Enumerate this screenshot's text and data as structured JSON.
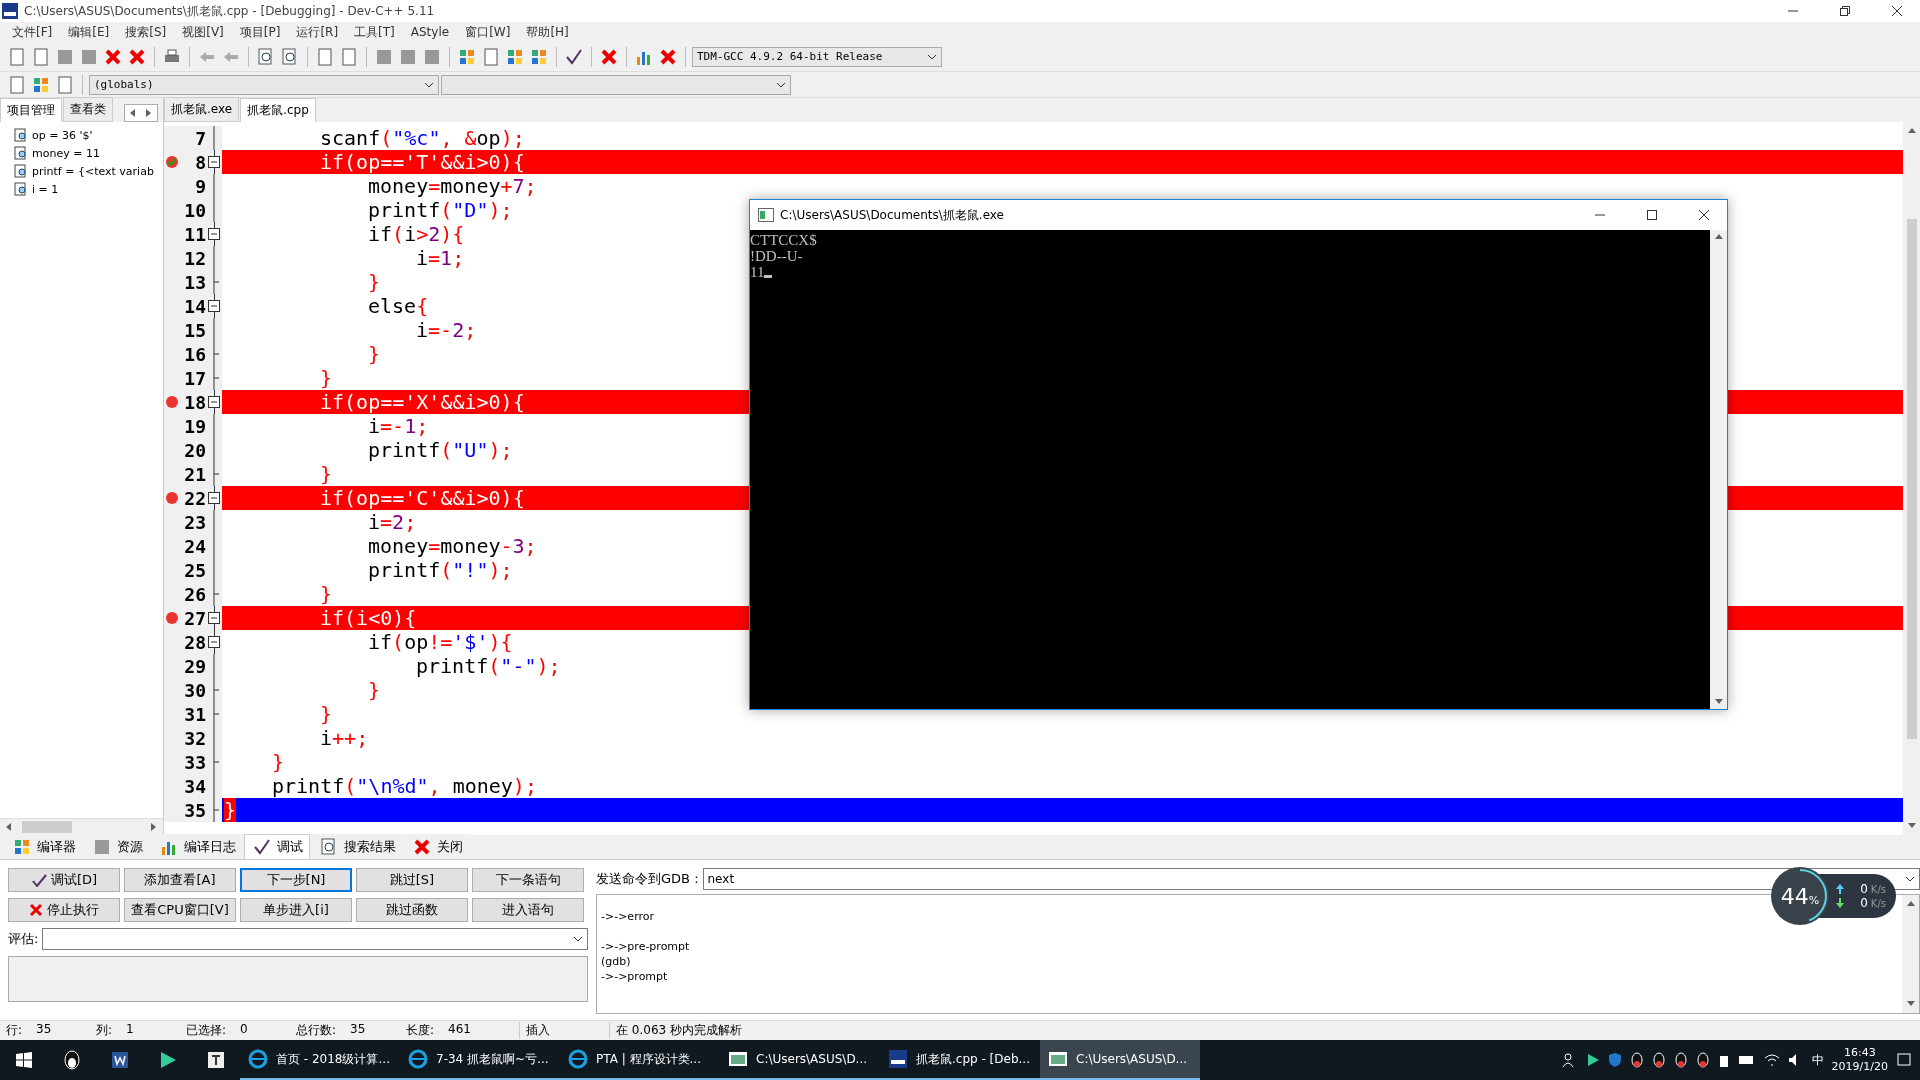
{
  "window": {
    "title": "C:\\Users\\ASUS\\Documents\\抓老鼠.cpp - [Debugging] - Dev-C++ 5.11"
  },
  "menu": [
    "文件[F]",
    "编辑[E]",
    "搜索[S]",
    "视图[V]",
    "项目[P]",
    "运行[R]",
    "工具[T]",
    "AStyle",
    "窗口[W]",
    "帮助[H]"
  ],
  "toolbar": {
    "compiler": "TDM-GCC 4.9.2 64-bit Release",
    "scope": "(globals)"
  },
  "side_tabs": [
    {
      "label": "项目管理",
      "selected": true
    },
    {
      "label": "查看类",
      "selected": false
    }
  ],
  "watches": [
    "op = 36 '$'",
    "money = 11",
    "printf = {<text variab",
    "i = 1"
  ],
  "editor_tabs": [
    {
      "label": "抓老鼠.exe",
      "selected": false
    },
    {
      "label": "抓老鼠.cpp",
      "selected": true
    }
  ],
  "lines": [
    {
      "children": [
        {
          "children": [
            {
              "number": "7",
              "kind": "plain",
              "fold_open": false,
              "fold_end": false,
              "tokens": [
                {
                  "t": "scanf",
                  "kind": "id"
                },
                {
                  "t": "(",
                  "kind": "sym"
                },
                {
                  "t": "\"%c\"",
                  "kind": "str"
                },
                {
                  "t": ", &",
                  "kind": "sym"
                },
                {
                  "t": "op",
                  "kind": "id"
                },
                {
                  "t": ");",
                  "kind": "sym"
                }
              ]
            },
            {
              "number": "8",
              "kind": "breakpoint",
              "fold_open": true,
              "fold_end": false,
              "tokens": [
                {
                  "t": "if(op=='T'&&i>0){",
                  "kind": "id"
                }
              ],
              "children": [
                {
                  "number": "9",
                  "kind": "plain",
                  "fold_open": false,
                  "fold_end": false,
                  "tokens": [
                    {
                      "t": "money",
                      "kind": "id"
                    },
                    {
                      "t": "=",
                      "kind": "sym"
                    },
                    {
                      "t": "money",
                      "kind": "id"
                    },
                    {
                      "t": "+",
                      "kind": "sym"
                    },
                    {
                      "t": "7",
                      "kind": "num"
                    },
                    {
                      "t": ";",
                      "kind": "sym"
                    }
                  ]
                },
                {
                  "number": "10",
                  "kind": "plain",
                  "fold_open": false,
                  "fold_end": false,
                  "tokens": [
                    {
                      "t": "printf",
                      "kind": "id"
                    },
                    {
                      "t": "(",
                      "kind": "sym"
                    },
                    {
                      "t": "\"D\"",
                      "kind": "str"
                    },
                    {
                      "t": ");",
                      "kind": "sym"
                    }
                  ]
                },
                {
                  "number": "11",
                  "kind": "plain",
                  "fold_open": true,
                  "fold_end": false,
                  "tokens": [
                    {
                      "t": "if",
                      "kind": "id"
                    },
                    {
                      "t": "(",
                      "kind": "sym"
                    },
                    {
                      "t": "i",
                      "kind": "id"
                    },
                    {
                      "t": ">",
                      "kind": "sym"
                    },
                    {
                      "t": "2",
                      "kind": "num"
                    },
                    {
                      "t": "){",
                      "kind": "sym"
                    }
                  ],
                  "children": [
                    {
                      "number": "12",
                      "kind": "plain",
                      "fold_open": false,
                      "fold_end": false,
                      "tokens": [
                        {
                          "t": "i",
                          "kind": "id"
                        },
                        {
                          "t": "=",
                          "kind": "sym"
                        },
                        {
                          "t": "1",
                          "kind": "num"
                        },
                        {
                          "t": ";",
                          "kind": "sym"
                        }
                      ]
                    }
                  ]
                },
                {
                  "number": "13",
                  "kind": "plain",
                  "fold_open": false,
                  "fold_end": true,
                  "tokens": [
                    {
                      "t": "}",
                      "kind": "sym"
                    }
                  ]
                },
                {
                  "number": "14",
                  "kind": "plain",
                  "fold_open": true,
                  "fold_end": false,
                  "tokens": [
                    {
                      "t": "else",
                      "kind": "id"
                    },
                    {
                      "t": "{",
                      "kind": "sym"
                    }
                  ],
                  "children": [
                    {
                      "number": "15",
                      "kind": "plain",
                      "fold_open": false,
                      "fold_end": false,
                      "tokens": [
                        {
                          "t": "i",
                          "kind": "id"
                        },
                        {
                          "t": "=-",
                          "kind": "sym"
                        },
                        {
                          "t": "2",
                          "kind": "num"
                        },
                        {
                          "t": ";",
                          "kind": "sym"
                        }
                      ]
                    }
                  ]
                },
                {
                  "number": "16",
                  "kind": "plain",
                  "fold_open": false,
                  "fold_end": true,
                  "tokens": [
                    {
                      "t": "}",
                      "kind": "sym"
                    }
                  ]
                }
              ]
            },
            {
              "number": "17",
              "kind": "plain",
              "fold_open": false,
              "fold_end": true,
              "tokens": [
                {
                  "t": "}",
                  "kind": "sym"
                }
              ]
            },
            {
              "number": "18",
              "kind": "breakpoint",
              "fold_open": true,
              "fold_end": false,
              "tokens": [
                {
                  "t": "if(op=='X'&&i>0){",
                  "kind": "id"
                }
              ],
              "children": [
                {
                  "number": "19",
                  "kind": "plain",
                  "fold_open": false,
                  "fold_end": false,
                  "tokens": [
                    {
                      "t": "i",
                      "kind": "id"
                    },
                    {
                      "t": "=-",
                      "kind": "sym"
                    },
                    {
                      "t": "1",
                      "kind": "num"
                    },
                    {
                      "t": ";",
                      "kind": "sym"
                    }
                  ]
                },
                {
                  "number": "20",
                  "kind": "plain",
                  "fold_open": false,
                  "fold_end": false,
                  "tokens": [
                    {
                      "t": "printf",
                      "kind": "id"
                    },
                    {
                      "t": "(",
                      "kind": "sym"
                    },
                    {
                      "t": "\"U\"",
                      "kind": "str"
                    },
                    {
                      "t": ");",
                      "kind": "sym"
                    }
                  ]
                }
              ]
            },
            {
              "number": "21",
              "kind": "plain",
              "fold_open": false,
              "fold_end": true,
              "tokens": [
                {
                  "t": "}",
                  "kind": "sym"
                }
              ]
            },
            {
              "number": "22",
              "kind": "breakpoint",
              "fold_open": true,
              "fold_end": false,
              "tokens": [
                {
                  "t": "if(op=='C'&&i>0){",
                  "kind": "id"
                }
              ],
              "children": [
                {
                  "number": "23",
                  "kind": "plain",
                  "fold_open": false,
                  "fold_end": false,
                  "tokens": [
                    {
                      "t": "i",
                      "kind": "id"
                    },
                    {
                      "t": "=",
                      "kind": "sym"
                    },
                    {
                      "t": "2",
                      "kind": "num"
                    },
                    {
                      "t": ";",
                      "kind": "sym"
                    }
                  ]
                },
                {
                  "number": "24",
                  "kind": "plain",
                  "fold_open": false,
                  "fold_end": false,
                  "tokens": [
                    {
                      "t": "money",
                      "kind": "id"
                    },
                    {
                      "t": "=",
                      "kind": "sym"
                    },
                    {
                      "t": "money",
                      "kind": "id"
                    },
                    {
                      "t": "-",
                      "kind": "sym"
                    },
                    {
                      "t": "3",
                      "kind": "num"
                    },
                    {
                      "t": ";",
                      "kind": "sym"
                    }
                  ]
                },
                {
                  "number": "25",
                  "kind": "plain",
                  "fold_open": false,
                  "fold_end": false,
                  "tokens": [
                    {
                      "t": "printf",
                      "kind": "id"
                    },
                    {
                      "t": "(",
                      "kind": "sym"
                    },
                    {
                      "t": "\"!\"",
                      "kind": "str"
                    },
                    {
                      "t": ");",
                      "kind": "sym"
                    }
                  ]
                }
              ]
            },
            {
              "number": "26",
              "kind": "plain",
              "fold_open": false,
              "fold_end": true,
              "tokens": [
                {
                  "t": "}",
                  "kind": "sym"
                }
              ]
            },
            {
              "number": "27",
              "kind": "breakpoint",
              "fold_open": true,
              "fold_end": false,
              "tokens": [
                {
                  "t": "if(i<0){",
                  "kind": "id"
                }
              ],
              "children": [
                {
                  "number": "28",
                  "kind": "plain",
                  "fold_open": true,
                  "fold_end": false,
                  "tokens": [
                    {
                      "t": "if",
                      "kind": "id"
                    },
                    {
                      "t": "(",
                      "kind": "sym"
                    },
                    {
                      "t": "op",
                      "kind": "id"
                    },
                    {
                      "t": "!=",
                      "kind": "sym"
                    },
                    {
                      "t": "'$'",
                      "kind": "str"
                    },
                    {
                      "t": "){",
                      "kind": "sym"
                    }
                  ],
                  "children": [
                    {
                      "number": "29",
                      "kind": "plain",
                      "fold_open": false,
                      "fold_end": false,
                      "tokens": [
                        {
                          "t": "printf",
                          "kind": "id"
                        },
                        {
                          "t": "(",
                          "kind": "sym"
                        },
                        {
                          "t": "\"-\"",
                          "kind": "str"
                        },
                        {
                          "t": ");",
                          "kind": "sym"
                        }
                      ]
                    }
                  ]
                },
                {
                  "number": "30",
                  "kind": "plain",
                  "fold_open": false,
                  "fold_end": true,
                  "tokens": [
                    {
                      "t": "}",
                      "kind": "sym"
                    }
                  ]
                }
              ]
            },
            {
              "number": "31",
              "kind": "plain",
              "fold_open": false,
              "fold_end": true,
              "tokens": [
                {
                  "t": "}",
                  "kind": "sym"
                }
              ]
            },
            {
              "number": "32",
              "kind": "plain",
              "fold_open": false,
              "fold_end": false,
              "tokens": [
                {
                  "t": "i",
                  "kind": "id"
                },
                {
                  "t": "++;",
                  "kind": "sym"
                }
              ]
            }
          ]
        },
        {
          "number": "33",
          "kind": "plain",
          "fold_open": false,
          "fold_end": true,
          "tokens": [
            {
              "t": "}",
              "kind": "sym"
            }
          ]
        },
        {
          "number": "34",
          "kind": "plain",
          "fold_open": false,
          "fold_end": false,
          "tokens": [
            {
              "t": "printf",
              "kind": "id"
            },
            {
              "t": "(",
              "kind": "sym"
            },
            {
              "t": "\"\\n%d\"",
              "kind": "str"
            },
            {
              "t": ", ",
              "kind": "sym"
            },
            {
              "t": "money",
              "kind": "id"
            },
            {
              "t": ");",
              "kind": "sym"
            }
          ]
        }
      ]
    },
    {
      "number": "35",
      "kind": "current",
      "fold_open": false,
      "fold_end": true,
      "tokens": [
        {
          "t": "}",
          "kind": "sym"
        }
      ]
    }
  ],
  "console": {
    "title": "C:\\Users\\ASUS\\Documents\\抓老鼠.exe",
    "lines": [
      "CTTCCX$",
      "!DD--U-",
      "11"
    ]
  },
  "bottom_tabs": [
    {
      "label": "编译器",
      "selected": false
    },
    {
      "label": "资源",
      "selected": false
    },
    {
      "label": "编译日志",
      "selected": false
    },
    {
      "label": "调试",
      "selected": true
    },
    {
      "label": "搜索结果",
      "selected": false
    },
    {
      "label": "关闭",
      "selected": false
    }
  ],
  "debug_buttons": [
    {
      "label": "调试[D]",
      "focused": false
    },
    {
      "label": "添加查看[A]",
      "focused": false
    },
    {
      "label": "下一步[N]",
      "focused": true
    },
    {
      "label": "跳过[S]",
      "focused": false
    },
    {
      "label": "下一条语句",
      "focused": false
    },
    {
      "label": "停止执行",
      "focused": false
    },
    {
      "label": "查看CPU窗口[V]",
      "focused": false
    },
    {
      "label": "单步进入[i]",
      "focused": false
    },
    {
      "label": "跳过函数",
      "focused": false
    },
    {
      "label": "进入语句",
      "focused": false
    }
  ],
  "evaluate": {
    "label": "评估:"
  },
  "gdb": {
    "label": "发送命令到GDB :",
    "value": "next",
    "output": [
      "->->error",
      "->->pre-prompt",
      "(gdb)",
      "->->prompt"
    ]
  },
  "net_widget": {
    "percent": "44",
    "percent_sign": "%",
    "level": 0.44,
    "up": "0",
    "up_unit": "K/s",
    "down": "0",
    "down_unit": "K/s"
  },
  "status_bar": [
    {
      "label": "行:",
      "value": "35"
    },
    {
      "label": "列:",
      "value": "1"
    },
    {
      "label": "已选择:",
      "value": "0"
    },
    {
      "label": "总行数:",
      "value": "35"
    },
    {
      "label": "长度:",
      "value": "461"
    },
    {
      "label": "插入"
    },
    {
      "label": "在 0.063 秒内完成解析"
    }
  ],
  "taskbar": {
    "windows": [
      {
        "label": "首页 - 2018级计算...",
        "kind": "browser",
        "selected": false
      },
      {
        "label": "7-34 抓老鼠啊~亏...",
        "kind": "browser",
        "selected": false
      },
      {
        "label": "PTA | 程序设计类...",
        "kind": "browser",
        "selected": false
      },
      {
        "label": "C:\\Users\\ASUS\\D...",
        "kind": "console",
        "selected": false
      },
      {
        "label": "抓老鼠.cpp - [Deb...",
        "kind": "ide",
        "selected": false
      },
      {
        "label": "C:\\Users\\ASUS\\D...",
        "kind": "console",
        "selected": true
      }
    ],
    "ime": "中",
    "time": "16:43",
    "date": "2019/1/20"
  }
}
